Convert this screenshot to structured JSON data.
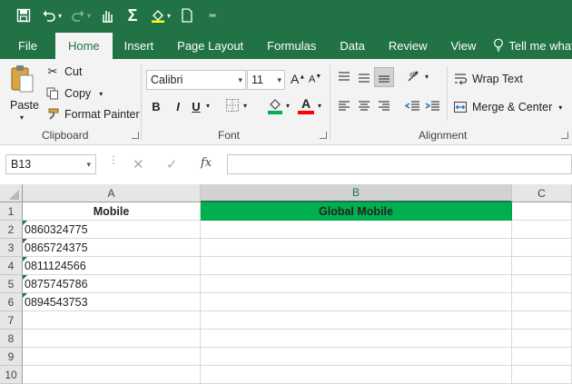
{
  "quick_access": {
    "icons": [
      "save-icon",
      "undo-icon",
      "redo-icon",
      "touch-mode-icon",
      "autosum-icon",
      "fill-color-icon",
      "new-file-icon",
      "customize-icon"
    ]
  },
  "tabs": [
    "File",
    "Home",
    "Insert",
    "Page Layout",
    "Formulas",
    "Data",
    "Review",
    "View"
  ],
  "active_tab": "Home",
  "tell_me": "Tell me what y",
  "clipboard": {
    "paste": "Paste",
    "cut": "Cut",
    "copy": "Copy",
    "format_painter": "Format Painter",
    "label": "Clipboard"
  },
  "font": {
    "name": "Calibri",
    "size": "11",
    "label": "Font",
    "bold": "B",
    "italic": "I",
    "underline": "U",
    "font_color": "#ff0000",
    "fill_color": "#00b050"
  },
  "alignment": {
    "wrap_text": "Wrap Text",
    "merge_center": "Merge & Center",
    "label": "Alignment"
  },
  "formula_bar": {
    "name_box": "B13",
    "fx": "fx",
    "content": ""
  },
  "sheet": {
    "columns": [
      "A",
      "B",
      "C"
    ],
    "selected_column": "B",
    "rows": [
      "1",
      "2",
      "3",
      "4",
      "5",
      "6",
      "7",
      "8",
      "9",
      "10"
    ],
    "header_a": "Mobile",
    "header_b": "Global Mobile",
    "header_b_fill": "#00b050",
    "mobile_numbers": [
      "0860324775",
      "0865724375",
      "0811124566",
      "0875745786",
      "0894543753"
    ]
  }
}
